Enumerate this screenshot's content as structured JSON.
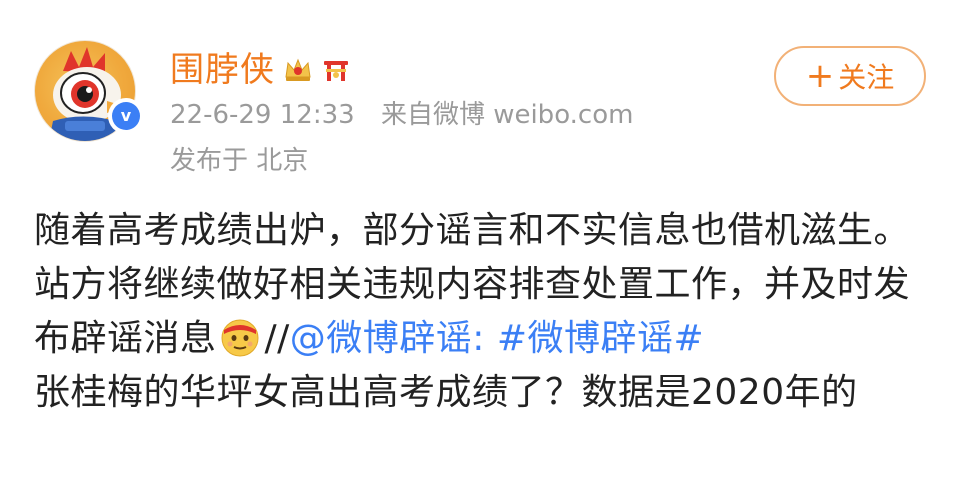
{
  "user": {
    "name": "围脖侠",
    "verified": true,
    "badges": [
      "crown-badge-icon",
      "lucky-gate-badge-icon"
    ],
    "post_time": "22-6-29 12:33",
    "source": "来自微博 weibo.com",
    "location": "发布于 北京"
  },
  "follow": {
    "plus": "+",
    "label": "关注"
  },
  "post": {
    "line1": "随着高考成绩出炉，部分谣言和不实信息也借机滋生。站方将继续做好相关违规内容排查处置工作，并及时发布辟谣消息",
    "slashes": "//",
    "mention": "@微博辟谣",
    "colon": ": ",
    "hashtag": "#微博辟谣#",
    "line2": "张桂梅的华坪女高出高考成绩了？数据是2020年的"
  },
  "colors": {
    "username": "#f07a1e",
    "link": "#3b7ff5",
    "meta": "#9a9a9a",
    "follow_border": "#f2b177",
    "verified": "#3b7ff5"
  }
}
